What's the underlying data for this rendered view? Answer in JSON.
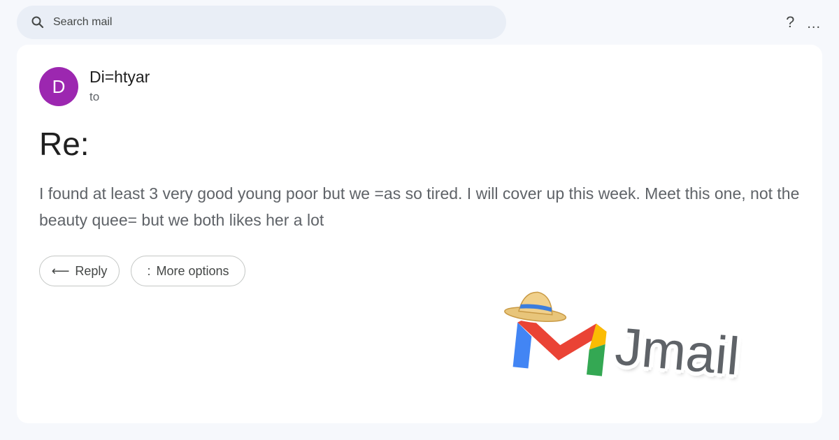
{
  "search": {
    "placeholder": "Search mail",
    "icon": "search-icon"
  },
  "toolbar": {
    "help_label": "?",
    "more_label": "..."
  },
  "message": {
    "avatar_initial": "D",
    "avatar_color": "#9c27b0",
    "sender": "Di=htyar",
    "recipient_label": "to",
    "subject": "Re:",
    "body": "I found at least 3 very good young poor but we =as so tired. I will cover up this week. Meet this one, not the beauty quee= but we both likes her a lot"
  },
  "actions": {
    "reply_icon": "⟵",
    "reply_label": "Reply",
    "more_icon": ":",
    "more_label": "More options"
  },
  "branding": {
    "wordmark": "Jmail",
    "colors": {
      "blue": "#4285f4",
      "red": "#ea4335",
      "yellow": "#fbbc04",
      "green": "#34a853"
    }
  }
}
